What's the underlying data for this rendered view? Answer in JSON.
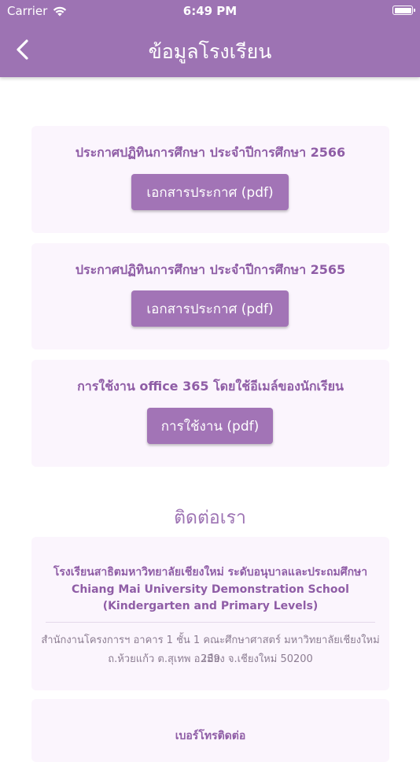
{
  "status_bar": {
    "carrier": "Carrier",
    "time": "6:49 PM"
  },
  "nav": {
    "title": "ข้อมูลโรงเรียน",
    "back_icon": "chevron-left-icon"
  },
  "documents": [
    {
      "title": "ประกาศปฏิทินการศึกษา ประจำปีการศึกษา 2566",
      "button": "เอกสารประกาศ (pdf)"
    },
    {
      "title": "ประกาศปฏิทินการศึกษา ประจำปีการศึกษา 2565",
      "button": "เอกสารประกาศ (pdf)"
    },
    {
      "title": "การใช้งาน office 365 โดยใช้อีเมล์ของนักเรียน",
      "button": "การใช้งาน (pdf)"
    }
  ],
  "contact": {
    "section_title": "ติดต่อเรา",
    "school_name_th": "โรงเรียนสาธิตมหาวิทยาลัยเชียงใหม่ ระดับอนุบาลและประถมศึกษา",
    "school_name_en": "Chiang Mai University Demonstration School (Kindergarten and Primary Levels)",
    "address_line1": "สำนักงานโครงการฯ อาคาร 1 ชั้น 1 คณะศึกษาศาสตร์ มหาวิทยาลัยเชียงใหม่ 239",
    "address_line2": "ถ.ห้วยแก้ว ต.สุเทพ อ.เมือง จ.เชียงใหม่ 50200",
    "phone_title": "เบอร์โทรติดต่อ"
  },
  "colors": {
    "header": "#9d73b3",
    "button": "#a274b6",
    "card": "#fbf5fd",
    "title_text": "#8f5da6"
  }
}
